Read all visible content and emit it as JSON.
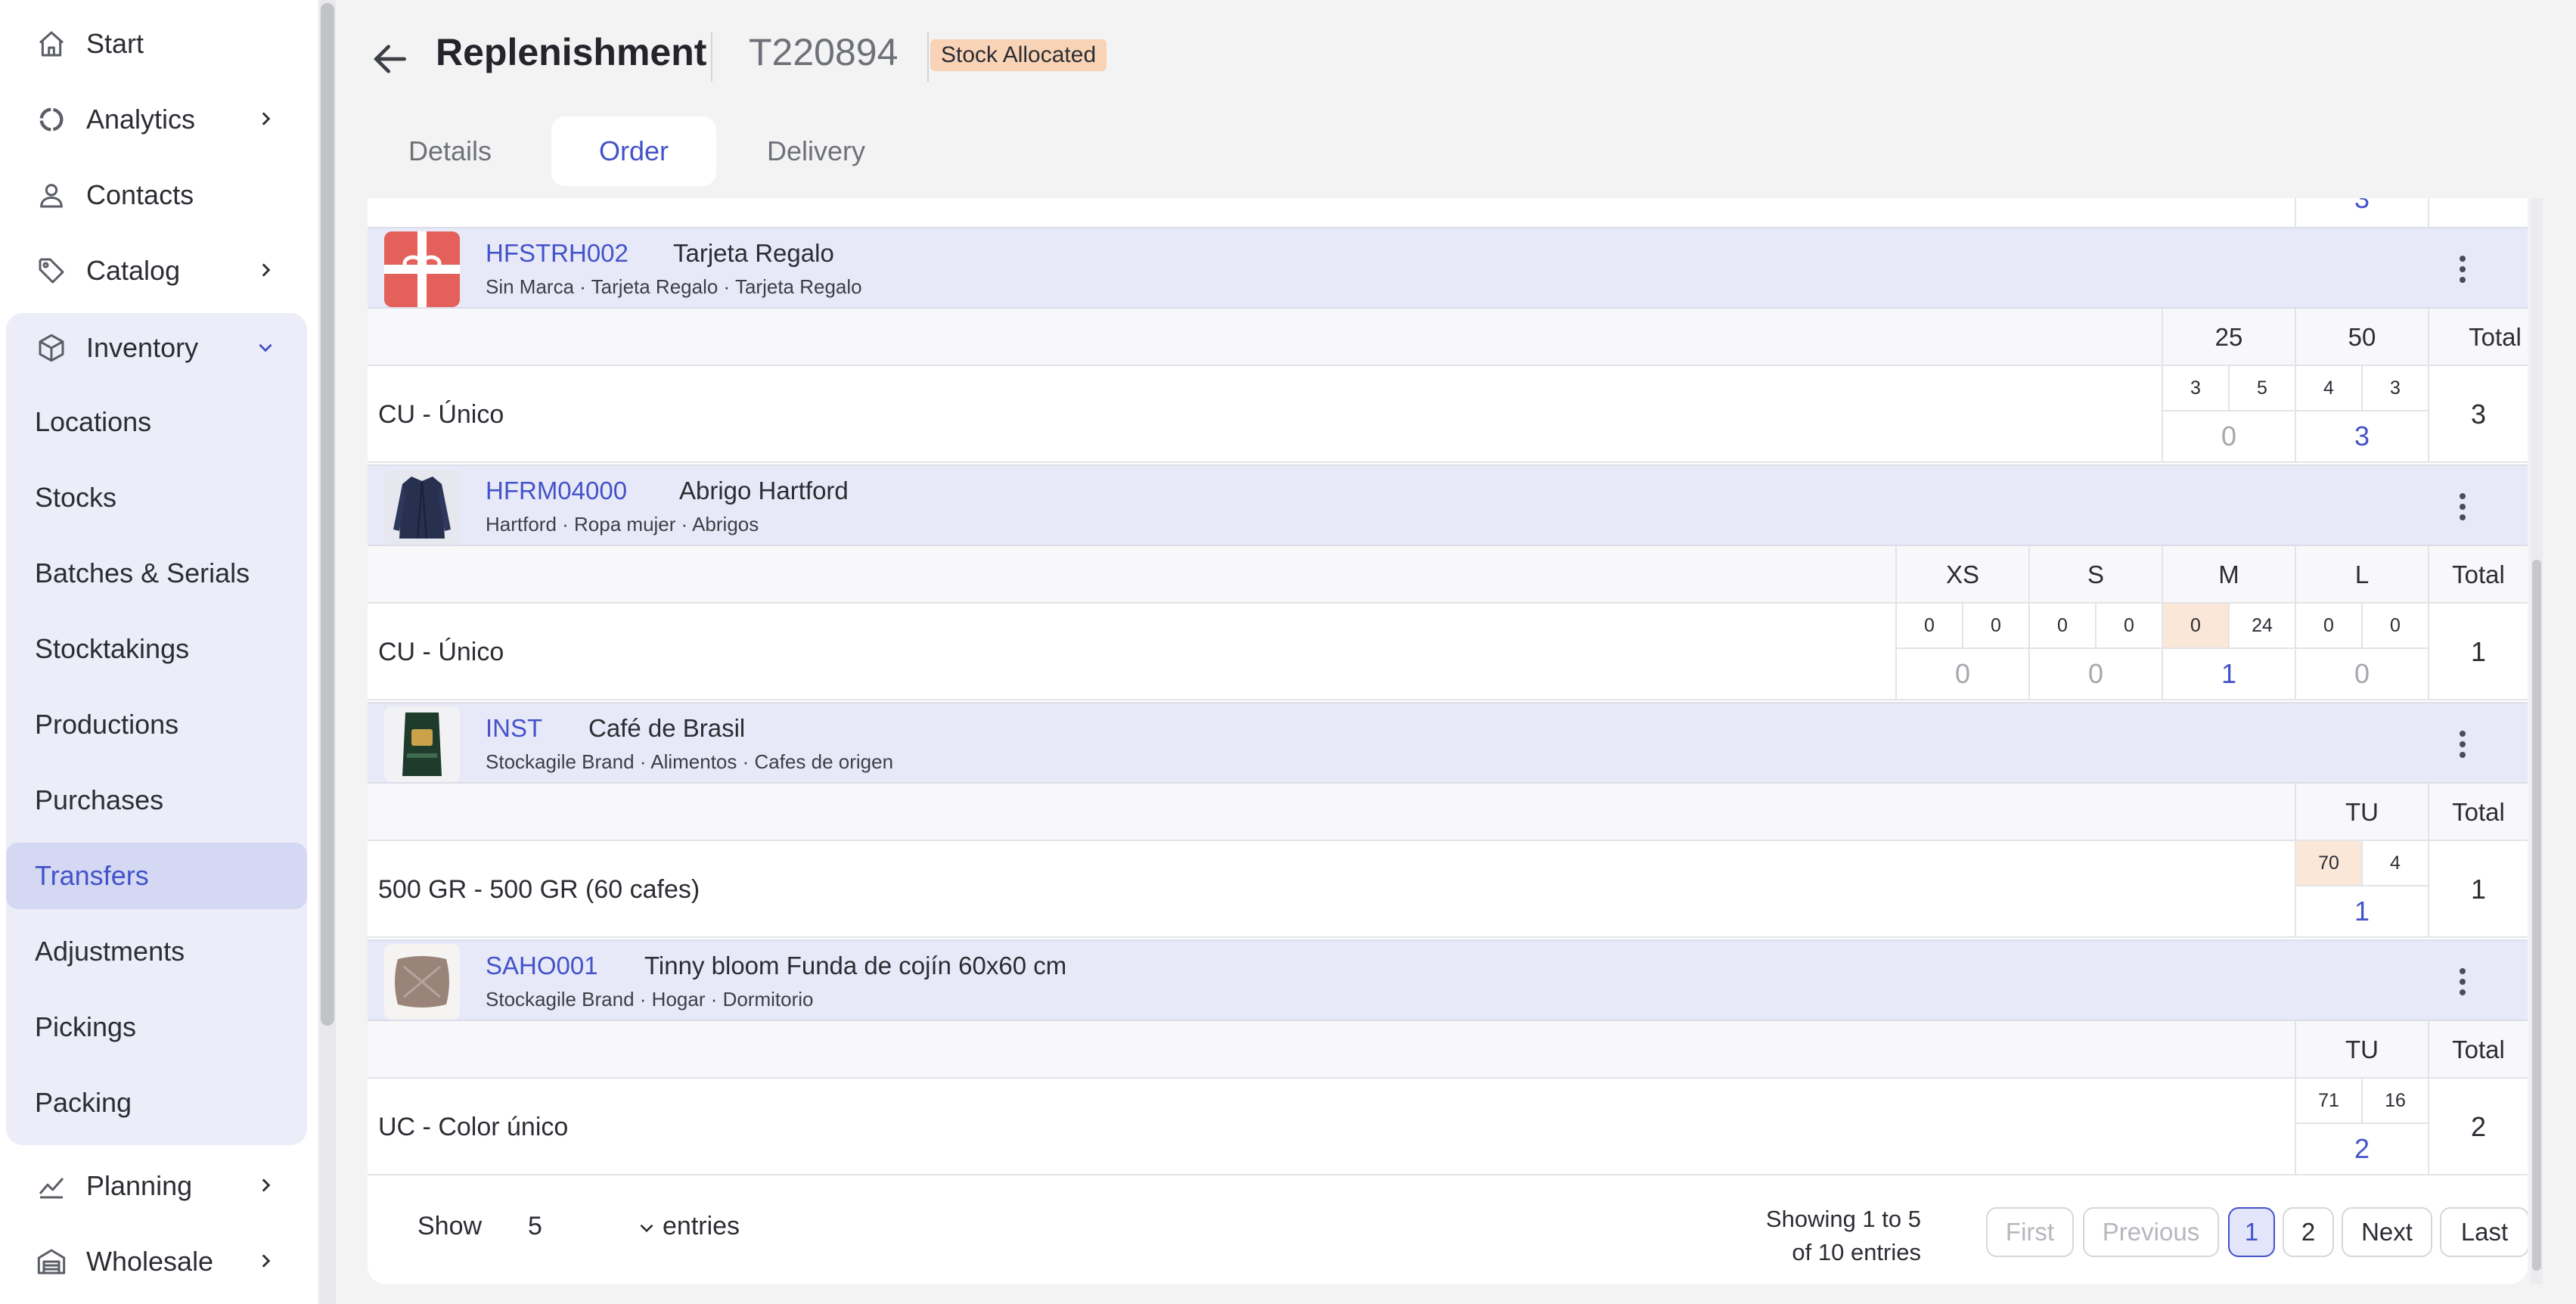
{
  "sidebar": {
    "items": [
      {
        "label": "Start",
        "icon": "home-icon"
      },
      {
        "label": "Analytics",
        "icon": "analytics-icon"
      },
      {
        "label": "Contacts",
        "icon": "user-icon"
      },
      {
        "label": "Catalog",
        "icon": "tag-icon"
      },
      {
        "label": "Inventory",
        "icon": "box-icon"
      },
      {
        "label": "Planning",
        "icon": "trend-icon"
      },
      {
        "label": "Wholesale",
        "icon": "warehouse-icon"
      }
    ],
    "inventory_sub": [
      "Locations",
      "Stocks",
      "Batches & Serials",
      "Stocktakings",
      "Productions",
      "Purchases",
      "Transfers",
      "Adjustments",
      "Pickings",
      "Packing"
    ],
    "active_sub": "Transfers"
  },
  "header": {
    "title": "Replenishment",
    "code": "T220894",
    "status": "Stock Allocated"
  },
  "tabs": [
    "Details",
    "Order",
    "Delivery"
  ],
  "active_tab": "Order",
  "partial_top_value": "3",
  "products": [
    {
      "code": "HFSTRH002",
      "name": "Tarjeta Regalo",
      "meta": "Sin Marca · Tarjeta Regalo · Tarjeta Regalo",
      "sizes": [
        "25",
        "50"
      ],
      "total_label": "Total",
      "variant": "CU - Único",
      "mini": [
        "3",
        "5",
        "4",
        "3"
      ],
      "qty": [
        "0",
        "3"
      ],
      "total": "3"
    },
    {
      "code": "HFRM04000",
      "name": "Abrigo Hartford",
      "meta": "Hartford · Ropa mujer · Abrigos",
      "sizes": [
        "XS",
        "S",
        "M",
        "L"
      ],
      "total_label": "Total",
      "variant": "CU - Único",
      "mini": [
        "0",
        "0",
        "0",
        "0",
        "0",
        "24",
        "0",
        "0"
      ],
      "qty": [
        "0",
        "0",
        "1",
        "0"
      ],
      "total": "1"
    },
    {
      "code": "INST",
      "name": "Café de Brasil",
      "meta": "Stockagile Brand · Alimentos · Cafes de origen",
      "sizes": [
        "TU"
      ],
      "total_label": "Total",
      "variant": "500 GR - 500 GR (60 cafes)",
      "mini": [
        "70",
        "4"
      ],
      "qty": [
        "1"
      ],
      "total": "1"
    },
    {
      "code": "SAHO001",
      "name": "Tinny bloom Funda de cojín 60x60 cm",
      "meta": "Stockagile Brand · Hogar · Dormitorio",
      "sizes": [
        "TU"
      ],
      "total_label": "Total",
      "variant": "UC - Color único",
      "mini": [
        "71",
        "16"
      ],
      "qty": [
        "2"
      ],
      "total": "2"
    }
  ],
  "footer": {
    "show_label": "Show",
    "page_size": "5",
    "entries_label": "entries",
    "showing_line1": "Showing 1 to 5",
    "showing_line2": "of 10 entries",
    "pagination": [
      "First",
      "Previous",
      "1",
      "2",
      "Next",
      "Last"
    ]
  },
  "colors": {
    "accent": "#4353c9",
    "active_bg": "#d5d8f3",
    "product_header_bg": "#e8e9f8",
    "status_bg": "#f9d3b6",
    "highlight_cell": "#fbe7d8"
  }
}
